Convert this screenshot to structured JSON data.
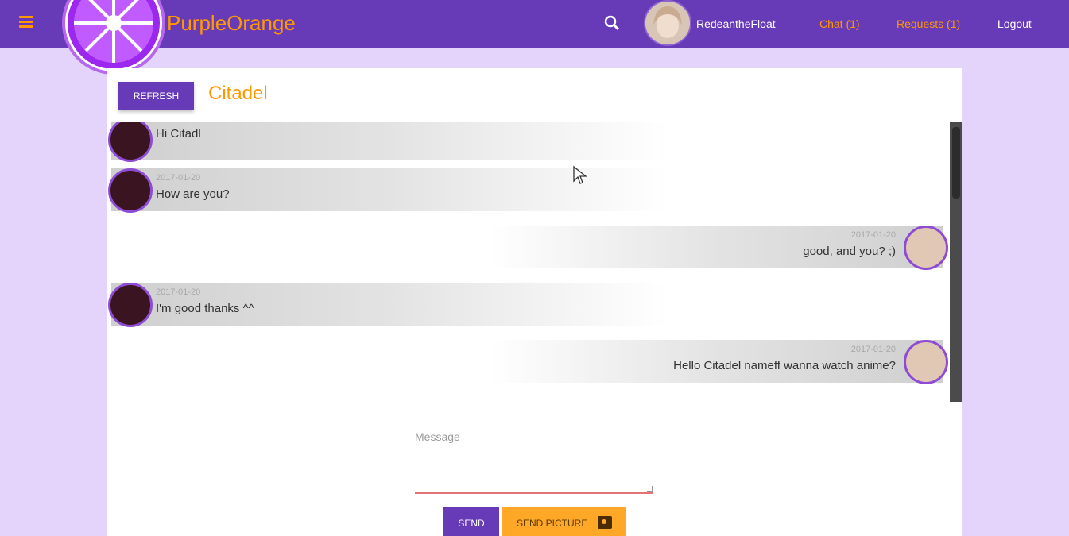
{
  "app": {
    "brand": "PurpleOrange",
    "username": "RedeantheFloat",
    "nav": {
      "chat": "Chat (1)",
      "requests": "Requests (1)",
      "logout": "Logout"
    }
  },
  "colors": {
    "primary": "#673ab7",
    "accent": "#ff9800",
    "page_background": "#e4d4fb",
    "bubble": "#cfcfcf"
  },
  "icons": {
    "menu": "menu-icon",
    "search": "search-icon",
    "camera": "camera-icon"
  },
  "chat": {
    "refresh_label": "Refresh",
    "title": "Citadel",
    "messages": [
      {
        "side": "left",
        "time": "",
        "text": "Hi Citadl"
      },
      {
        "side": "left",
        "time": "2017-01-20",
        "text": "How are you?"
      },
      {
        "side": "right",
        "time": "2017-01-20",
        "text": "good, and you? ;)"
      },
      {
        "side": "left",
        "time": "2017-01-20",
        "text": "I'm good thanks ^^"
      },
      {
        "side": "right",
        "time": "2017-01-20",
        "text": "Hello Citadel nameff wanna watch anime?"
      }
    ]
  },
  "composer": {
    "placeholder": "Message",
    "send_label": "Send",
    "picture_label": "Send Picture"
  }
}
